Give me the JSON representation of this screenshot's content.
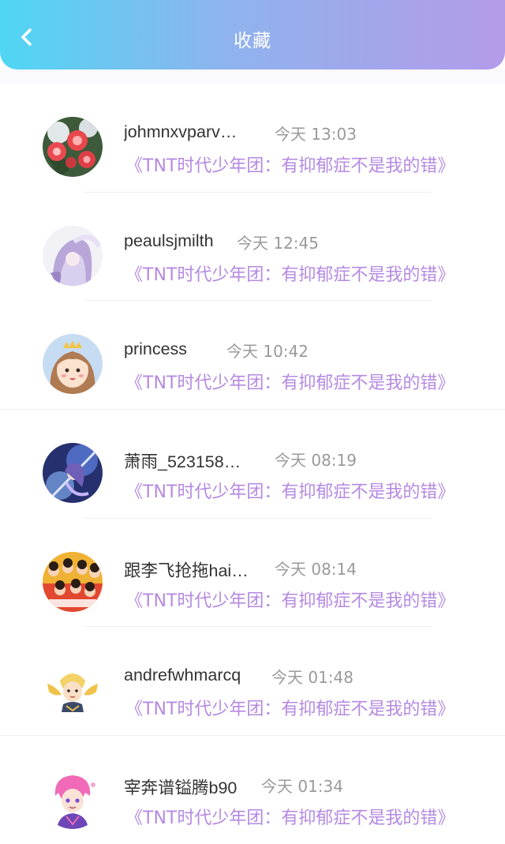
{
  "header": {
    "title": "收藏",
    "back_icon": "chevron-left-icon"
  },
  "colors": {
    "gradient_start": "#4fd6f3",
    "gradient_end": "#b49be9",
    "quote": "#b58ae2",
    "time": "#9a9a9a"
  },
  "favorites": [
    {
      "name": "johmnxvparv…",
      "time": "今天 13:03",
      "title": "《TNT时代少年团：有抑郁症不是我的错》",
      "avatar": "roses-avatar"
    },
    {
      "name": "peaulsjmilth",
      "time": "今天 12:45",
      "title": "《TNT时代少年团：有抑郁症不是我的错》",
      "avatar": "anime-girl-avatar"
    },
    {
      "name": "princess",
      "time": "今天 10:42",
      "title": "《TNT时代少年团：有抑郁症不是我的错》",
      "avatar": "princess-avatar"
    },
    {
      "name": "萧雨_523158…",
      "time": "今天 08:19",
      "title": "《TNT时代少年团：有抑郁症不是我的错》",
      "avatar": "game-character-avatar"
    },
    {
      "name": "跟李飞抢拖hai…",
      "time": "今天 08:14",
      "title": "《TNT时代少年团：有抑郁症不是我的错》",
      "avatar": "group-photo-avatar"
    },
    {
      "name": "andrefwhmarcq",
      "time": "今天 01:48",
      "title": "《TNT时代少年团：有抑郁症不是我的错》",
      "avatar": "winged-hero-avatar"
    },
    {
      "name": "宰奔谱镒腾b90",
      "time": "今天 01:34",
      "title": "《TNT时代少年团：有抑郁症不是我的错》",
      "avatar": "pink-hair-avatar"
    }
  ]
}
